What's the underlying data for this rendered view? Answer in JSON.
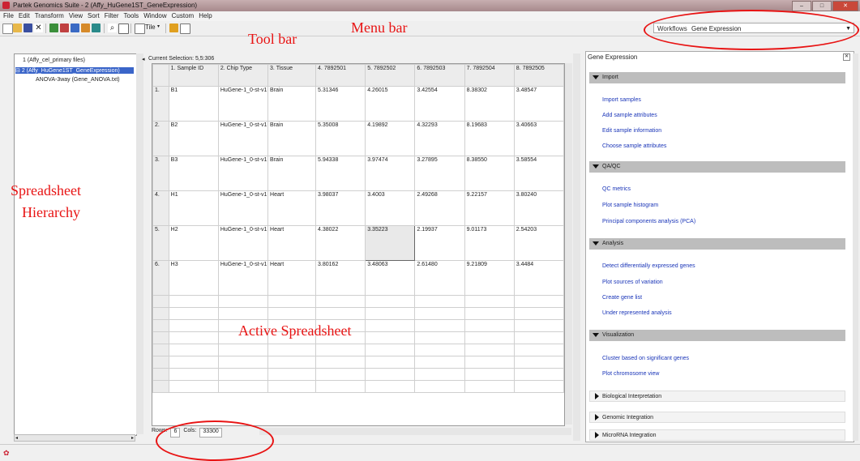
{
  "window": {
    "title": "Partek Genomics Suite - 2 (Affy_HuGene1ST_GeneExpression)",
    "controls": [
      "–",
      "□",
      "✕"
    ]
  },
  "menu": [
    "File",
    "Edit",
    "Transform",
    "View",
    "Sort",
    "Filter",
    "Tools",
    "Window",
    "Custom",
    "Help"
  ],
  "toolbar": {
    "tile_label": "Tile"
  },
  "workflow": {
    "label": "Workflows",
    "value": "Gene Expression"
  },
  "tree": {
    "items": [
      "1 (Affy_cel_primary files)",
      "2 (Affy_HuGene1ST_GeneExpression)",
      "ANOVA-3way (Gene_ANOVA.txt)"
    ]
  },
  "sheet": {
    "selection_label": "Current Selection: 5,5:306",
    "columns": [
      "",
      "1.\nSample ID",
      "2.\nChip Type",
      "3.\nTissue",
      "4.\n7892501",
      "5.\n7892502",
      "6.\n7892503",
      "7.\n7892504",
      "8.\n7892505"
    ],
    "rows": [
      [
        "1.",
        "B1",
        "HuGene-1_0-st-v1",
        "Brain",
        "5.31346",
        "4.26015",
        "3.42554",
        "8.38302",
        "3.48547"
      ],
      [
        "2.",
        "B2",
        "HuGene-1_0-st-v1",
        "Brain",
        "5.35008",
        "4.19892",
        "4.32293",
        "8.19683",
        "3.40663"
      ],
      [
        "3.",
        "B3",
        "HuGene-1_0-st-v1",
        "Brain",
        "5.94338",
        "3.97474",
        "3.27895",
        "8.38550",
        "3.58554"
      ],
      [
        "4.",
        "H1",
        "HuGene-1_0-st-v1",
        "Heart",
        "3.98037",
        "3.4003",
        "2.49268",
        "9.22157",
        "3.80240"
      ],
      [
        "5.",
        "H2",
        "HuGene-1_0-st-v1",
        "Heart",
        "4.38022",
        "3.35223",
        "2.19937",
        "9.01173",
        "2.54203"
      ],
      [
        "6.",
        "H3",
        "HuGene-1_0-st-v1",
        "Heart",
        "3.80162",
        "3.48063",
        "2.61480",
        "9.21809",
        "3.4484"
      ]
    ],
    "status": {
      "rows_label": "Rows:",
      "rows_value": "6",
      "cols_label": "Cols:",
      "cols_value": "33300"
    }
  },
  "workflow_panel": {
    "title": "Gene Expression",
    "close": "✕",
    "sections": [
      {
        "label": "Import",
        "tasks": [
          "Import samples",
          "Add sample attributes",
          "Edit sample information",
          "Choose sample attributes"
        ]
      },
      {
        "label": "QA/QC",
        "tasks": [
          "QC metrics",
          "Plot sample histogram",
          "Principal components analysis (PCA)"
        ]
      },
      {
        "label": "Analysis",
        "tasks": [
          "Detect differentially expressed genes",
          "Plot sources of variation",
          "Create gene list",
          "Under represented analysis"
        ]
      },
      {
        "label": "Visualization",
        "tasks": [
          "Cluster based on significant genes",
          "Plot chromosome view"
        ]
      },
      {
        "label": "Biological Interpretation",
        "tasks": []
      },
      {
        "label": "Genomic Integration",
        "tasks": []
      },
      {
        "label": "MicroRNA Integration",
        "tasks": []
      }
    ]
  },
  "annotations": {
    "menu_bar": "Menu bar",
    "tool_bar": "Tool bar",
    "spreadsheet_hierarchy_line1": "Spreadsheet",
    "spreadsheet_hierarchy_line2": "Hierarchy",
    "active_spreadsheet": "Active Spreadsheet"
  },
  "colors": {
    "annotation_red": "#e81414",
    "selected_blue": "#3a65c9",
    "link_blue": "#1a35b8"
  }
}
